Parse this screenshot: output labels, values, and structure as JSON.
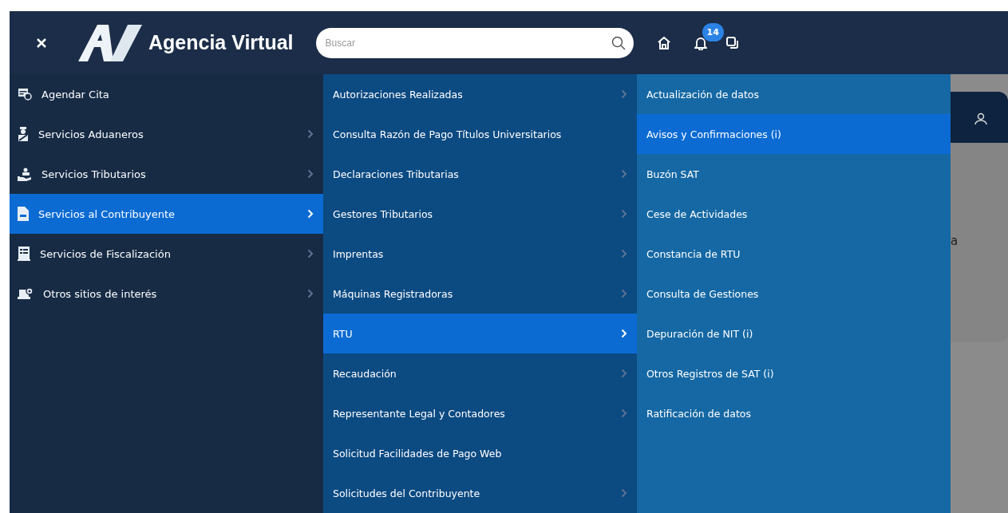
{
  "header": {
    "brand": "Agencia Virtual",
    "search": {
      "placeholder": "Buscar"
    },
    "notification_count": "14"
  },
  "menu_level_1": [
    {
      "label": "Agendar Cita",
      "kind": "calendar",
      "has_submenu": false,
      "selected": false
    },
    {
      "label": "Servicios Aduaneros",
      "kind": "officer",
      "has_submenu": true,
      "selected": false
    },
    {
      "label": "Servicios Tributarios",
      "kind": "hand",
      "has_submenu": true,
      "selected": false
    },
    {
      "label": "Servicios al Contribuyente",
      "kind": "document",
      "has_submenu": true,
      "selected": true
    },
    {
      "label": "Servicios de Fiscalización",
      "kind": "list",
      "has_submenu": true,
      "selected": false
    },
    {
      "label": "Otros sitios de interés",
      "kind": "laptop",
      "has_submenu": true,
      "selected": false
    }
  ],
  "menu_level_2": [
    {
      "label": "Autorizaciones Realizadas",
      "has_submenu": true,
      "selected": false
    },
    {
      "label": "Consulta Razón de Pago Títulos Universitarios",
      "has_submenu": false,
      "selected": false
    },
    {
      "label": "Declaraciones Tributarias",
      "has_submenu": true,
      "selected": false
    },
    {
      "label": "Gestores Tributarios",
      "has_submenu": true,
      "selected": false
    },
    {
      "label": "Imprentas",
      "has_submenu": true,
      "selected": false
    },
    {
      "label": "Máquinas Registradoras",
      "has_submenu": true,
      "selected": false
    },
    {
      "label": "RTU",
      "has_submenu": true,
      "selected": true
    },
    {
      "label": "Recaudación",
      "has_submenu": true,
      "selected": false
    },
    {
      "label": "Representante Legal y Contadores",
      "has_submenu": true,
      "selected": false
    },
    {
      "label": "Solicitud Facilidades de Pago Web",
      "has_submenu": false,
      "selected": false
    },
    {
      "label": "Solicitudes del Contribuyente",
      "has_submenu": true,
      "selected": false
    }
  ],
  "menu_level_3": [
    {
      "label": "Actualización de datos",
      "selected": false
    },
    {
      "label": "Avisos y Confirmaciones (i)",
      "selected": true
    },
    {
      "label": "Buzón SAT",
      "selected": false
    },
    {
      "label": "Cese de Actividades",
      "selected": false
    },
    {
      "label": "Constancia de RTU",
      "selected": false
    },
    {
      "label": "Consulta de Gestiones",
      "selected": false
    },
    {
      "label": "Depuración de NIT (i)",
      "selected": false
    },
    {
      "label": "Otros Registros de SAT (i)",
      "selected": false
    },
    {
      "label": "Ratificación de datos",
      "selected": false
    }
  ],
  "background_text": "a"
}
